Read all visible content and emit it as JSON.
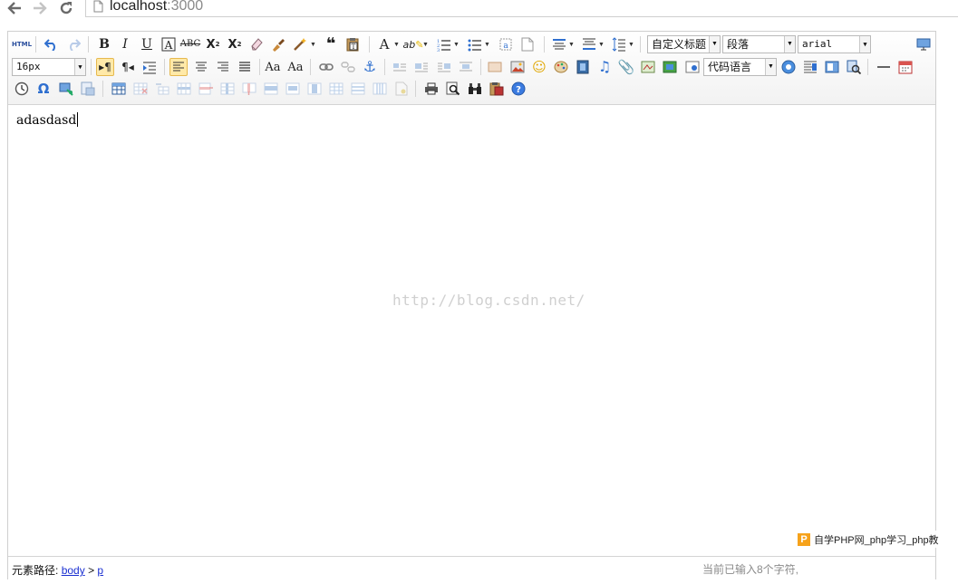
{
  "browser": {
    "url_host": "localhost",
    "url_port": ":3000"
  },
  "toolbar": {
    "heading_select": "自定义标题",
    "paragraph_select": "段落",
    "font_family_select": "arial",
    "font_size_select": "16px",
    "code_language_select": "代码语言",
    "html_label": "HTML"
  },
  "content": {
    "text": "adasdasd",
    "watermark": "http://blog.csdn.net/"
  },
  "statusbar": {
    "path_label": "元素路径:",
    "path_body": "body",
    "path_sep": ">",
    "path_p": "p",
    "word_count": "当前已输入8个字符,"
  },
  "badge": {
    "logo": "P",
    "text": "自学PHP网_php学习_php教"
  }
}
